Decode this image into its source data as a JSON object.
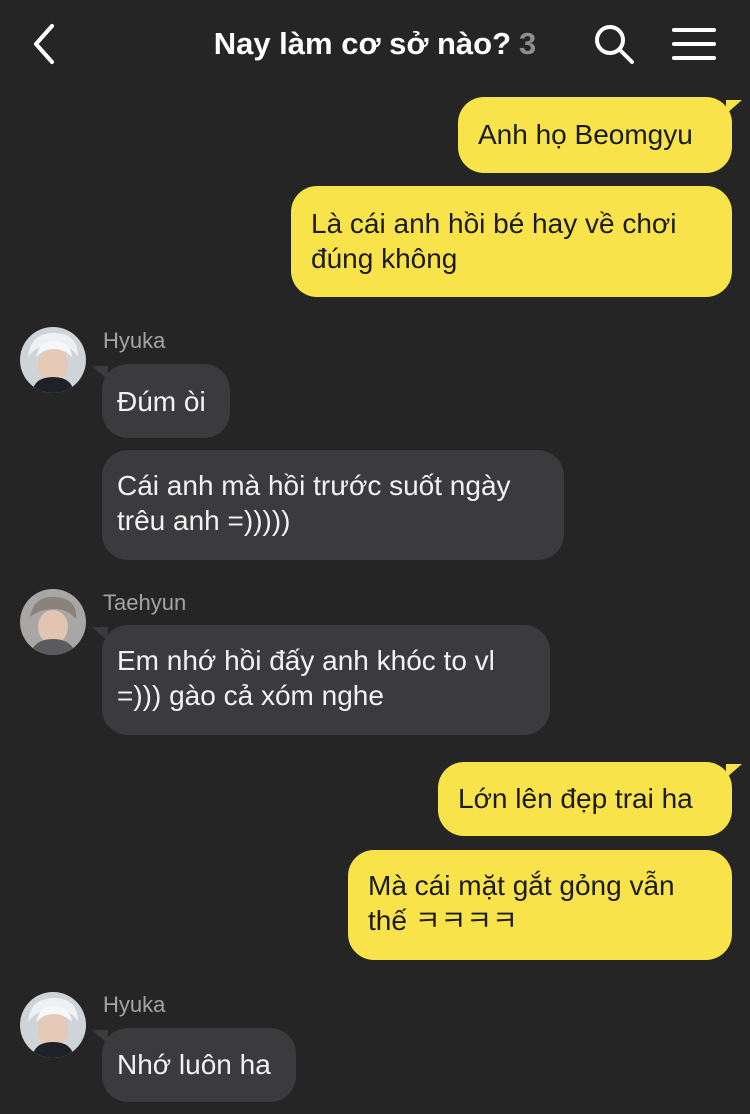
{
  "header": {
    "title": "Nay làm cơ sở nào?",
    "member_count": "3"
  },
  "messages": {
    "m1": "Anh họ Beomgyu",
    "m2": "Là cái anh hồi bé hay về chơi\nđúng không",
    "m3_sender": "Hyuka",
    "m3": "Đúm òi",
    "m4": "Cái anh mà hồi trước suốt ngày\ntrêu anh =)))))",
    "m5_sender": "Taehyun",
    "m5": "Em nhớ hồi đấy anh khóc to vl\n=))) gào cả xóm nghe",
    "m6": "Lớn lên đẹp trai ha",
    "m7": "Mà cái mặt gắt gỏng vẫn\nthế ㅋㅋㅋㅋ",
    "m8_sender": "Hyuka",
    "m8": "Nhớ luôn ha"
  },
  "colors": {
    "background": "#252526",
    "my_bubble": "#f8e34a",
    "other_bubble": "#3b3b3d"
  },
  "icons": [
    "back-arrow-icon",
    "search-icon",
    "menu-icon"
  ]
}
